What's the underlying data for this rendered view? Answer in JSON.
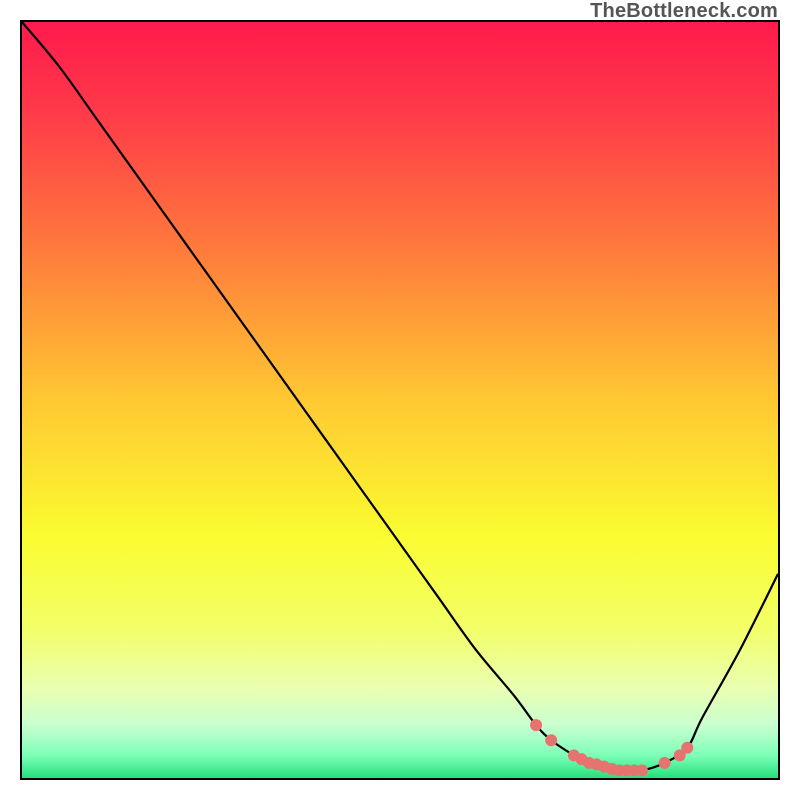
{
  "watermark": "TheBottleneck.com",
  "chart_data": {
    "type": "line",
    "title": "",
    "xlabel": "",
    "ylabel": "",
    "xlim": [
      0,
      100
    ],
    "ylim": [
      0,
      100
    ],
    "series": [
      {
        "name": "bottleneck-curve",
        "x": [
          0,
          5,
          10,
          15,
          20,
          25,
          30,
          35,
          40,
          45,
          50,
          55,
          60,
          65,
          68,
          70,
          73,
          75,
          78,
          80,
          82,
          85,
          88,
          90,
          95,
          100
        ],
        "y": [
          100,
          94,
          87,
          80,
          73,
          66,
          59,
          52,
          45,
          38,
          31,
          24,
          17,
          11,
          7,
          5,
          3,
          2,
          1,
          1,
          1,
          2,
          4,
          8,
          17,
          27
        ]
      }
    ],
    "markers": {
      "name": "highlight-dots",
      "color": "#e6736f",
      "x": [
        68,
        70,
        73,
        74,
        75,
        76,
        77,
        78,
        79,
        80,
        81,
        82,
        85,
        87,
        88
      ],
      "y": [
        7,
        5,
        3,
        2.5,
        2,
        1.8,
        1.5,
        1.2,
        1,
        1,
        1,
        1,
        2,
        3,
        4
      ]
    },
    "background": {
      "type": "vertical-gradient",
      "stops": [
        {
          "pos": 0.0,
          "color": "#ff1a4d"
        },
        {
          "pos": 0.12,
          "color": "#ff3a49"
        },
        {
          "pos": 0.3,
          "color": "#ff7a3c"
        },
        {
          "pos": 0.5,
          "color": "#ffc832"
        },
        {
          "pos": 0.68,
          "color": "#fafc30"
        },
        {
          "pos": 0.8,
          "color": "#f3ff66"
        },
        {
          "pos": 0.88,
          "color": "#eaffb0"
        },
        {
          "pos": 0.93,
          "color": "#c9ffd0"
        },
        {
          "pos": 0.97,
          "color": "#7dffb8"
        },
        {
          "pos": 1.0,
          "color": "#24e07e"
        }
      ]
    }
  }
}
